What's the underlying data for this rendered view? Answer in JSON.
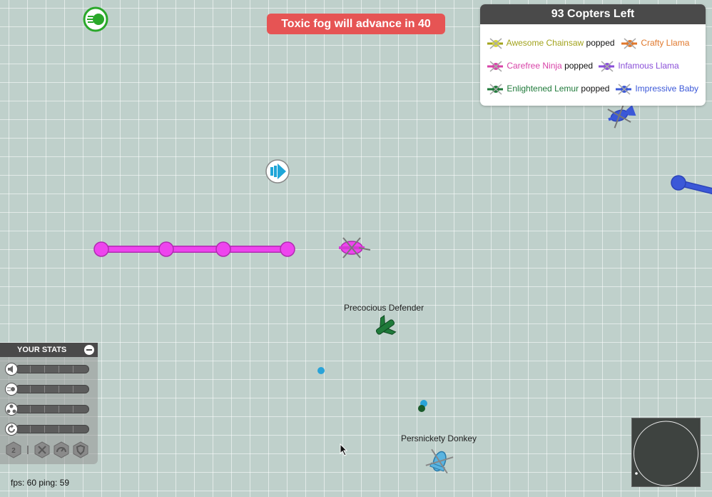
{
  "banner": {
    "text": "Toxic fog will advance in 40",
    "color": "#e65454"
  },
  "leaderboard": {
    "title": "93 Copters Left",
    "feed": [
      {
        "name": "Awesome Chainsaw",
        "name_color": "#a2a31c",
        "verb": "popped",
        "icon": "copter-icon"
      },
      {
        "name": "Crafty Llama",
        "name_color": "#e0782c",
        "verb": "",
        "icon": "copter-icon"
      },
      {
        "name": "Carefree Ninja",
        "name_color": "#d843a8",
        "verb": "popped",
        "icon": "copter-icon"
      },
      {
        "name": "Infamous Llama",
        "name_color": "#8a4fd8",
        "verb": "",
        "icon": "copter-icon"
      },
      {
        "name": "Enlightened Lemur",
        "name_color": "#1f7a3a",
        "verb": "popped",
        "icon": "copter-icon"
      },
      {
        "name": "Impressive Baby",
        "name_color": "#3b58d8",
        "verb": "",
        "icon": "copter-icon"
      }
    ]
  },
  "players": [
    {
      "label": "Precocious Defender",
      "color": "#1f7a3a"
    },
    {
      "label": "Persnickety Donkey",
      "color": "#5ab4e0"
    }
  ],
  "stats_panel": {
    "title": "YOUR STATS",
    "stats": [
      {
        "icon": "speaker-icon",
        "level": 0
      },
      {
        "icon": "bullet-speed-icon",
        "level": 0
      },
      {
        "icon": "multi-shot-icon",
        "level": 0
      },
      {
        "icon": "reload-icon",
        "level": 0
      }
    ],
    "upgrades": [
      {
        "icon": "upgrade-points-icon",
        "label": "2"
      },
      {
        "icon": "tools-icon",
        "label": ""
      },
      {
        "icon": "gauge-icon",
        "label": ""
      },
      {
        "icon": "shield-icon",
        "label": ""
      }
    ]
  },
  "hud": {
    "fps_text": "fps: 60 ping: 59"
  },
  "pickups": [
    {
      "icon": "speed-boost-pickup-icon",
      "color": "#2aa82a"
    },
    {
      "icon": "sound-wave-pickup-icon",
      "color": "#1fa6d8"
    }
  ],
  "colors": {
    "arena": "#bfd0cb",
    "laser": "#ee44ee",
    "blue_laser": "#3b58d8",
    "minimap": "#3e4340"
  }
}
